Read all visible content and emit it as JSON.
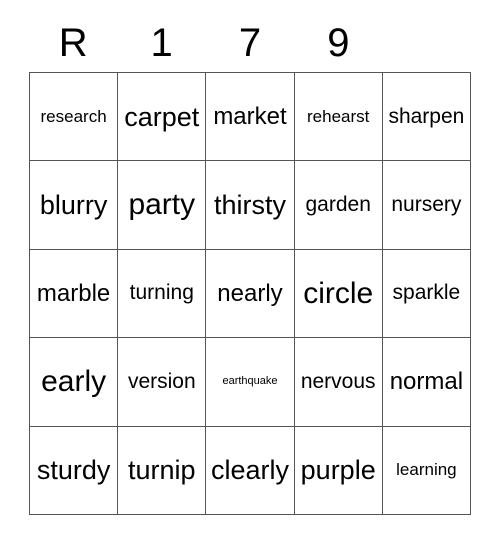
{
  "card": {
    "type": "bingo-card",
    "columns": 5,
    "rows": 5,
    "headers": [
      "R",
      "1",
      "7",
      "9",
      ""
    ],
    "grid": [
      [
        {
          "text": "research",
          "size": "fs-sm"
        },
        {
          "text": "carpet",
          "size": "fs-xl"
        },
        {
          "text": "market",
          "size": "fs-lg"
        },
        {
          "text": "rehearst",
          "size": "fs-sm"
        },
        {
          "text": "sharpen",
          "size": "fs-md"
        }
      ],
      [
        {
          "text": "blurry",
          "size": "fs-xl"
        },
        {
          "text": "party",
          "size": "fs-xxl"
        },
        {
          "text": "thirsty",
          "size": "fs-xl"
        },
        {
          "text": "garden",
          "size": "fs-md"
        },
        {
          "text": "nursery",
          "size": "fs-md"
        }
      ],
      [
        {
          "text": "marble",
          "size": "fs-lg"
        },
        {
          "text": "turning",
          "size": "fs-md"
        },
        {
          "text": "nearly",
          "size": "fs-lg"
        },
        {
          "text": "circle",
          "size": "fs-xxl"
        },
        {
          "text": "sparkle",
          "size": "fs-md"
        }
      ],
      [
        {
          "text": "early",
          "size": "fs-xxl"
        },
        {
          "text": "version",
          "size": "fs-md"
        },
        {
          "text": "earthquake",
          "size": "fs-xs"
        },
        {
          "text": "nervous",
          "size": "fs-md"
        },
        {
          "text": "normal",
          "size": "fs-lg"
        }
      ],
      [
        {
          "text": "sturdy",
          "size": "fs-xl"
        },
        {
          "text": "turnip",
          "size": "fs-xl"
        },
        {
          "text": "clearly",
          "size": "fs-xl"
        },
        {
          "text": "purple",
          "size": "fs-xl"
        },
        {
          "text": "learning",
          "size": "fs-sm"
        }
      ]
    ],
    "colors": {
      "background": "#ffffff",
      "text": "#000000",
      "grid_line": "#555555"
    }
  }
}
